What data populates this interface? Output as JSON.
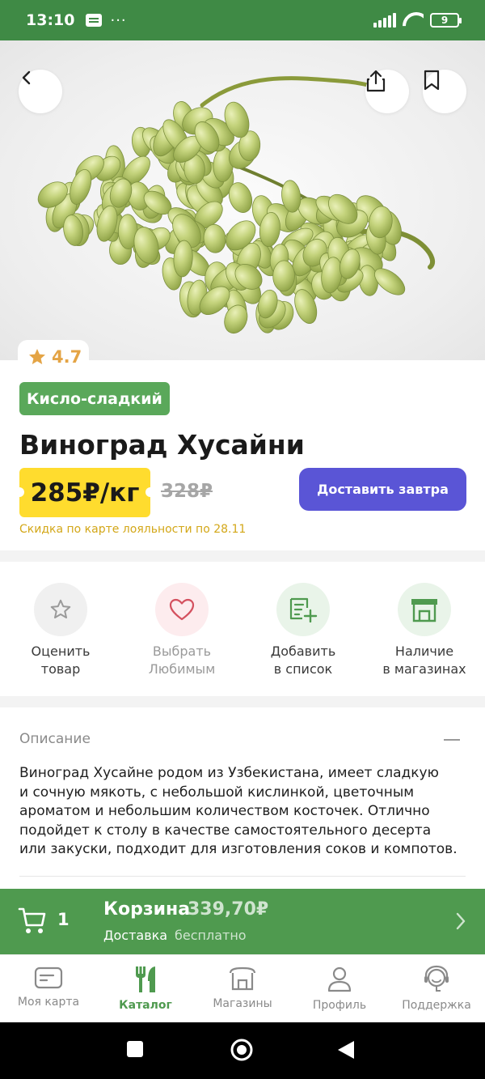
{
  "status_bar": {
    "time": "13:10",
    "dots": "···",
    "battery": "9"
  },
  "hero": {
    "image_subject": "grapes-photo",
    "back_icon": "chevron-left-icon",
    "share_icon": "share-icon",
    "bookmark_icon": "bookmark-icon"
  },
  "product": {
    "rating": "4.7",
    "taste_badge": "Кисло-сладкий",
    "title": "Виноград Хусайни",
    "price": "285₽/кг",
    "old_price": "328₽",
    "deliver_button": "Доставить завтра",
    "discount_note": "Скидка по карте лояльности по 28.11"
  },
  "actions": [
    {
      "label_1": "Оценить",
      "label_2": "товар",
      "icon": "star-icon"
    },
    {
      "label_1": "Выбрать",
      "label_2": "Любимым",
      "icon": "heart-icon"
    },
    {
      "label_1": "Добавить",
      "label_2": "в список",
      "icon": "add-to-list-icon"
    },
    {
      "label_1": "Наличие",
      "label_2": "в магазинах",
      "icon": "store-icon"
    }
  ],
  "description": {
    "title": "Описание",
    "lines": [
      "Виноград Хусайне родом из Узбекистана, имеет сладкую",
      "и сочную мякоть, с небольшой кислинкой, цветочным",
      "ароматом и небольшим количеством косточек. Отлично",
      "подойдет к столу в качестве самостоятельного десерта",
      "или закуски, подходит для изготовления соков и компотов."
    ]
  },
  "cart": {
    "count": "1",
    "title": "Корзина",
    "sum": "339,70₽",
    "delivery_label": "Доставка",
    "delivery_value": "бесплатно"
  },
  "bottom_nav": [
    {
      "label": "Моя карта",
      "icon": "card-icon",
      "active": false
    },
    {
      "label": "Каталог",
      "icon": "fork-knife-icon",
      "active": true
    },
    {
      "label": "Магазины",
      "icon": "store-icon",
      "active": false
    },
    {
      "label": "Профиль",
      "icon": "profile-icon",
      "active": false
    },
    {
      "label": "Поддержка",
      "icon": "support-icon",
      "active": false
    }
  ],
  "colors": {
    "brand_green": "#4f9a4f",
    "status_green": "#3f8a45",
    "price_yellow": "#ffdc2e",
    "primary_button": "#5a55d6",
    "rating_orange": "#e4a445"
  }
}
